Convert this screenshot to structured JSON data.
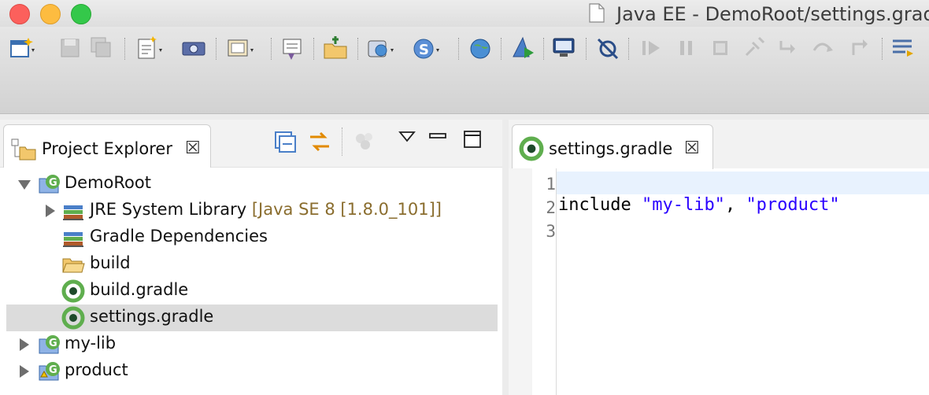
{
  "window": {
    "title": "Java EE - DemoRoot/settings.gradle",
    "colors": {
      "close": "#fc605c",
      "minimize": "#fdbc40",
      "maximize": "#34c84a"
    }
  },
  "toolbar": {
    "icons": [
      "new-wizard-icon",
      "save-icon",
      "save-all-icon",
      "new-file-icon",
      "camera-icon",
      "open-type-icon",
      "open-task-icon",
      "open-perspective-icon",
      "new-server-icon",
      "new-spring-icon",
      "web-browser-icon",
      "run-with-coverage-icon",
      "display-icon",
      "skip-breakpoints-icon",
      "resume-icon",
      "suspend-icon",
      "terminate-icon",
      "disconnect-icon",
      "step-into-icon",
      "step-over-icon",
      "step-return-icon",
      "task-list-icon"
    ]
  },
  "project_explorer": {
    "tab_label": "Project Explorer",
    "close_glyph": "☒",
    "tree": [
      {
        "label": "DemoRoot",
        "decor": "",
        "icon": "gradle-project-icon",
        "expanded": true
      },
      {
        "label": "JRE System Library",
        "decor": "[Java SE 8 [1.8.0_101]]",
        "icon": "library-icon"
      },
      {
        "label": "Gradle Dependencies",
        "decor": "",
        "icon": "library-icon"
      },
      {
        "label": "build",
        "decor": "",
        "icon": "folder-icon"
      },
      {
        "label": "build.gradle",
        "decor": "",
        "icon": "gradle-file-icon"
      },
      {
        "label": "settings.gradle",
        "decor": "",
        "icon": "gradle-file-icon",
        "selected": true
      },
      {
        "label": "my-lib",
        "decor": "",
        "icon": "gradle-project-icon",
        "expanded": false
      },
      {
        "label": "product",
        "decor": "",
        "icon": "gradle-project-icon",
        "expanded": false
      }
    ]
  },
  "editor": {
    "tab_label": "settings.gradle",
    "close_glyph": "☒",
    "line_numbers": [
      "1",
      "2",
      "3"
    ],
    "code": {
      "keyword": "include ",
      "str1": "\"my-lib\"",
      "sep": ", ",
      "str2": "\"product\""
    },
    "colors": {
      "string": "#2a00ff",
      "current_line": "#e8f2fe",
      "selection": "#dcdcdc"
    }
  }
}
